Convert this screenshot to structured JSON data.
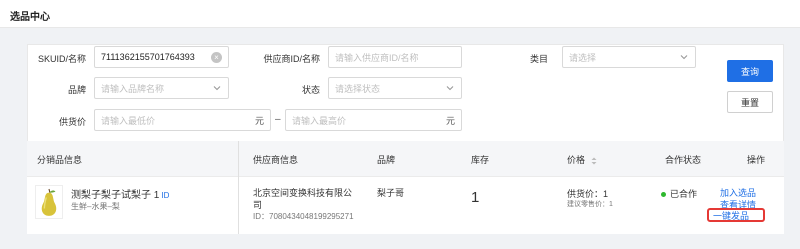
{
  "page": {
    "title": "选品中心"
  },
  "filters": {
    "skuid": {
      "label": "SKUID/名称",
      "value": "7111362155701764393"
    },
    "supplier": {
      "label": "供应商ID/名称",
      "placeholder": "请输入供应商ID/名称"
    },
    "category": {
      "label": "类目",
      "placeholder": "请选择"
    },
    "brand": {
      "label": "品牌",
      "placeholder": "请输入品牌名称"
    },
    "status": {
      "label": "状态",
      "placeholder": "请选择状态"
    },
    "price": {
      "label": "供货价",
      "min_placeholder": "请输入最低价",
      "max_placeholder": "请输入最高价",
      "unit": "元",
      "separator": "–"
    }
  },
  "buttons": {
    "search": "查询",
    "reset": "重置"
  },
  "table": {
    "headers": {
      "product": "分销品信息",
      "supplier": "供应商信息",
      "brand": "品牌",
      "stock": "库存",
      "price": "价格",
      "coop_status": "合作状态",
      "actions": "操作"
    },
    "rows": [
      {
        "name": "测梨子梨子试梨子 1",
        "id_tag": "ID",
        "category": "生鲜–水果–梨",
        "supplier_name_line1": "北京空间变换科技有限公",
        "supplier_name_line2": "司",
        "supplier_id": "ID：7080434048199295271",
        "brand": "梨子哥",
        "stock": "1",
        "supply_price": "供货价：1",
        "suggested_price": "建议零售价：1",
        "coop_status": "已合作",
        "actions": {
          "add": "加入选品",
          "detail": "查看详情",
          "publish": "一键发品"
        }
      }
    ]
  },
  "colors": {
    "primary": "#1f6fe5",
    "success": "#2eb82e",
    "highlight": "#e53935"
  }
}
